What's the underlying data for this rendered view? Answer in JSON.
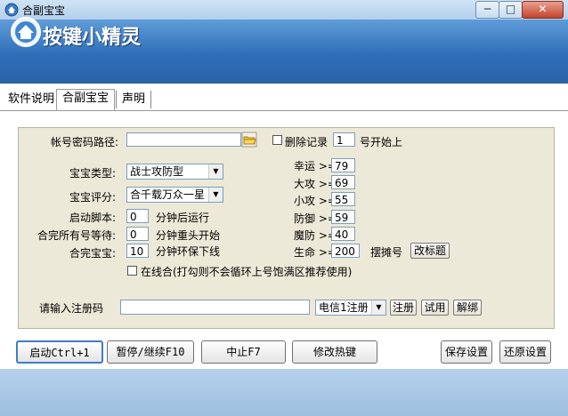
{
  "window": {
    "title": "合副宝宝",
    "minimize": "─",
    "maximize": "□",
    "close": "✕"
  },
  "banner": {
    "title": "按键小精灵",
    "logo_icon": "house-icon"
  },
  "tabs": [
    "软件说明",
    "合副宝宝",
    "声明"
  ],
  "form": {
    "account_label": "帐号密码路径:",
    "account_value": "",
    "delete_record_label": "删除记录",
    "start_number": "1",
    "start_suffix": "号开始上",
    "baby_type_label": "宝宝类型:",
    "baby_type_value": "战士攻防型",
    "baby_score_label": "宝宝评分:",
    "baby_score_value": "合千载万众一星",
    "start_script_label": "启动脚本:",
    "start_script_value": "0",
    "start_script_suffix": "分钟后运行",
    "wait_label": "合完所有号等待:",
    "wait_value": "0",
    "wait_suffix": "分钟重头开始",
    "finish_label": "合完宝宝:",
    "finish_value": "10",
    "finish_suffix": "分钟环保下线",
    "online_merge_label": "在线合(打勾则不会循环上号饱满区推荐使用)",
    "stats": [
      {
        "label": "幸运 >=",
        "value": "79"
      },
      {
        "label": "大攻 >=",
        "value": "69"
      },
      {
        "label": "小攻 >=",
        "value": "55"
      },
      {
        "label": "防御 >=",
        "value": "59"
      },
      {
        "label": "魔防 >=",
        "value": "40"
      },
      {
        "label": "生命 >=",
        "value": "200"
      }
    ],
    "stall_button": "摆摊号",
    "rename_button": "改标题",
    "reg_label": "请输入注册码",
    "reg_value": "",
    "server_value": "电信1注册",
    "register_button": "注册",
    "trial_button": "试用",
    "unbind_button": "解绑"
  },
  "bottom": {
    "start": "启动Ctrl+1",
    "pause": "暂停/继续F10",
    "stop": "中止F7",
    "hotkey": "修改热键",
    "save": "保存设置",
    "restore": "还原设置"
  }
}
